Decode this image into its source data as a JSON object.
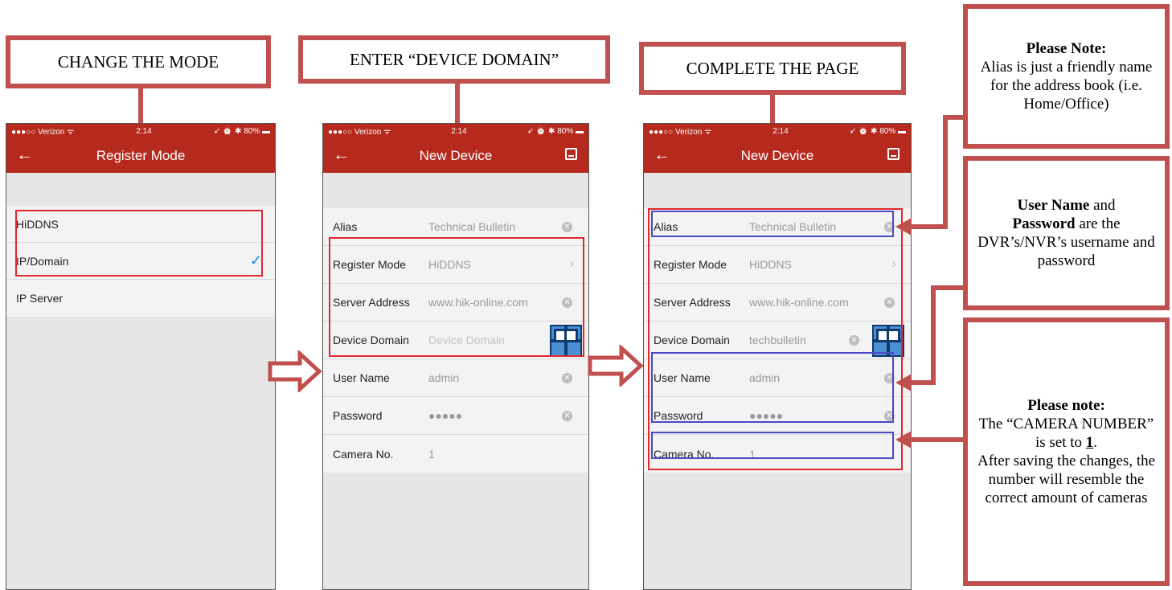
{
  "callouts": {
    "change_mode": "CHANGE THE MODE",
    "enter_domain": "ENTER “DEVICE DOMAIN”",
    "complete_page": "COMPLETE THE PAGE"
  },
  "notes": {
    "alias_title": "Please Note:",
    "alias_body": "Alias is just a friendly name for the address book (i.e. Home/Office)",
    "user_bold1": "User Name",
    "user_and": " and",
    "user_bold2": "Password",
    "user_body": " are the DVR’s/NVR’s username and password",
    "camera_title": "Please note:",
    "camera_body1": "The “CAMERA NUMBER” is set to ",
    "camera_num": "1",
    "camera_body2": ".",
    "camera_body3": "After saving the changes, the number will resemble the correct amount of cameras"
  },
  "status_bar": {
    "carrier": "●●●○○ Verizon ᯤ",
    "time": "2:14",
    "right": "➶ ⏰ ✱ 80% ▬"
  },
  "screen1": {
    "title": "Register Mode",
    "items": [
      {
        "label": "HiDDNS"
      },
      {
        "label": "IP/Domain",
        "selected": true
      },
      {
        "label": "IP Server"
      }
    ]
  },
  "screen2": {
    "title": "New Device",
    "rows": [
      {
        "label": "Alias",
        "value": "Technical Bulletin"
      },
      {
        "label": "Register Mode",
        "value": "HiDDNS"
      },
      {
        "label": "Server Address",
        "value": "www.hik-online.com"
      },
      {
        "label": "Device Domain",
        "placeholder": "Device Domain"
      },
      {
        "label": "User Name",
        "value": "admin"
      },
      {
        "label": "Password",
        "value": "●●●●●"
      },
      {
        "label": "Camera No.",
        "value": "1"
      }
    ]
  },
  "screen3": {
    "title": "New Device",
    "rows": [
      {
        "label": "Alias",
        "value": "Technical Bulletin"
      },
      {
        "label": "Register Mode",
        "value": "HiDDNS"
      },
      {
        "label": "Server Address",
        "value": "www.hik-online.com"
      },
      {
        "label": "Device Domain",
        "value": "techbulletin"
      },
      {
        "label": "User Name",
        "value": "admin"
      },
      {
        "label": "Password",
        "value": "●●●●●"
      },
      {
        "label": "Camera No.",
        "value": "1"
      }
    ]
  },
  "colors": {
    "accent": "#c0504d",
    "navbar": "#b52a1d",
    "highlight_red": "#e0282e",
    "highlight_blue": "#4a4ac6",
    "check": "#1e88e5"
  }
}
